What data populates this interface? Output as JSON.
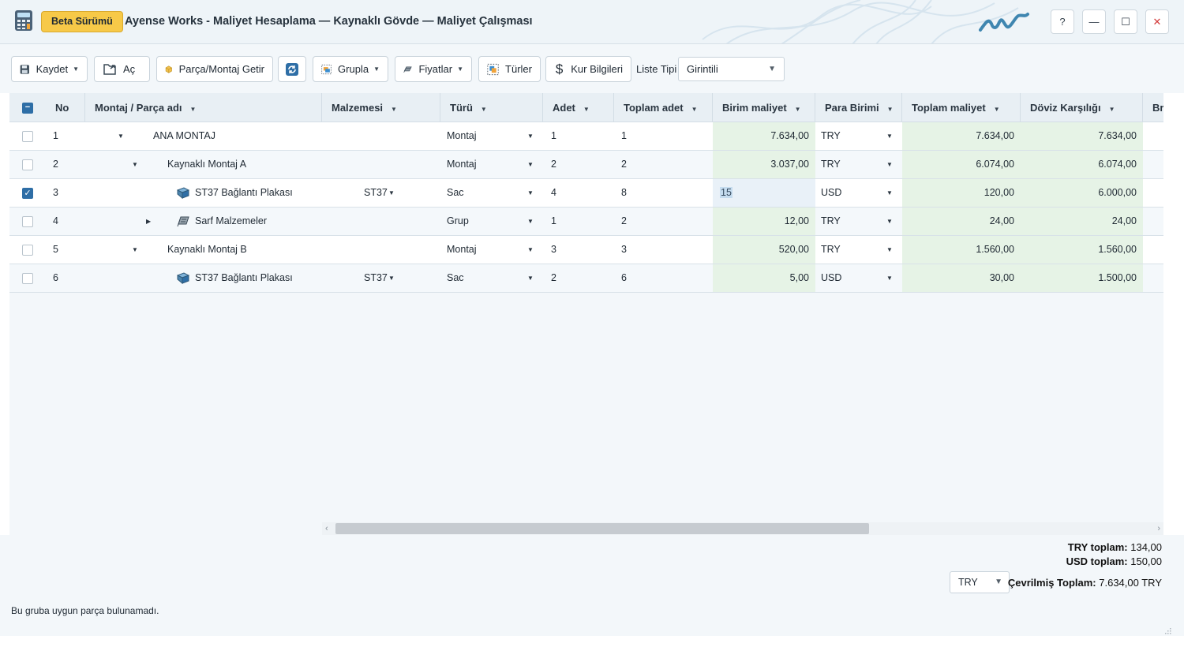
{
  "titlebar": {
    "beta_label": "Beta Sürümü",
    "title": "Ayense Works - Maliyet Hesaplama — Kaynaklı Gövde — Maliyet Çalışması",
    "help_label": "?",
    "minimize_label": "—",
    "maximize_label": "☐",
    "close_label": "✕"
  },
  "toolbar": {
    "save_label": "Kaydet",
    "open_label": "Aç",
    "fetch_label": "Parça/Montaj Getir",
    "group_label": "Grupla",
    "prices_label": "Fiyatlar",
    "types_label": "Türler",
    "rates_label": "Kur Bilgileri",
    "list_type_label": "Liste Tipi",
    "list_type_value": "Girintili"
  },
  "grid": {
    "columns": {
      "no": "No",
      "name": "Montaj / Parça adı",
      "material": "Malzemesi",
      "type": "Türü",
      "qty": "Adet",
      "total_qty": "Toplam adet",
      "unit_cost": "Birim maliyet",
      "currency": "Para Birimi",
      "total_cost": "Toplam maliyet",
      "fx": "Döviz Karşılığı",
      "extra": "Bri"
    },
    "rows": [
      {
        "no": "1",
        "name": "ANA MONTAJ",
        "material": "",
        "type": "Montaj",
        "qty": "1",
        "total_qty": "1",
        "unit_cost": "7.634,00",
        "currency": "TRY",
        "total_cost": "7.634,00",
        "fx": "7.634,00",
        "checked": false
      },
      {
        "no": "2",
        "name": "Kaynaklı Montaj A",
        "material": "",
        "type": "Montaj",
        "qty": "2",
        "total_qty": "2",
        "unit_cost": "3.037,00",
        "currency": "TRY",
        "total_cost": "6.074,00",
        "fx": "6.074,00",
        "checked": false
      },
      {
        "no": "3",
        "name": "ST37 Bağlantı Plakası",
        "material": "ST37",
        "type": "Sac",
        "qty": "4",
        "total_qty": "8",
        "unit_cost": "15",
        "currency": "USD",
        "total_cost": "120,00",
        "fx": "6.000,00",
        "checked": true
      },
      {
        "no": "4",
        "name": "Sarf Malzemeler",
        "material": "",
        "type": "Grup",
        "qty": "1",
        "total_qty": "2",
        "unit_cost": "12,00",
        "currency": "TRY",
        "total_cost": "24,00",
        "fx": "24,00",
        "checked": false
      },
      {
        "no": "5",
        "name": "Kaynaklı Montaj B",
        "material": "",
        "type": "Montaj",
        "qty": "3",
        "total_qty": "3",
        "unit_cost": "520,00",
        "currency": "TRY",
        "total_cost": "1.560,00",
        "fx": "1.560,00",
        "checked": false
      },
      {
        "no": "6",
        "name": "ST37 Bağlantı Plakası",
        "material": "ST37",
        "type": "Sac",
        "qty": "2",
        "total_qty": "6",
        "unit_cost": "5,00",
        "currency": "USD",
        "total_cost": "30,00",
        "fx": "1.500,00",
        "checked": false
      }
    ]
  },
  "footer": {
    "try_total_label": "TRY toplam:",
    "try_total_value": "134,00",
    "usd_total_label": "USD toplam:",
    "usd_total_value": "150,00",
    "target_currency": "TRY",
    "converted_label": "Çevrilmiş Toplam:",
    "converted_value": "7.634,00 TRY",
    "status": "Bu gruba uygun parça bulunamadı."
  },
  "colors": {
    "accent": "#2e6ea6",
    "beta": "#f7c948",
    "cost_highlight": "#e6f3e6",
    "close": "#d33a3a"
  }
}
